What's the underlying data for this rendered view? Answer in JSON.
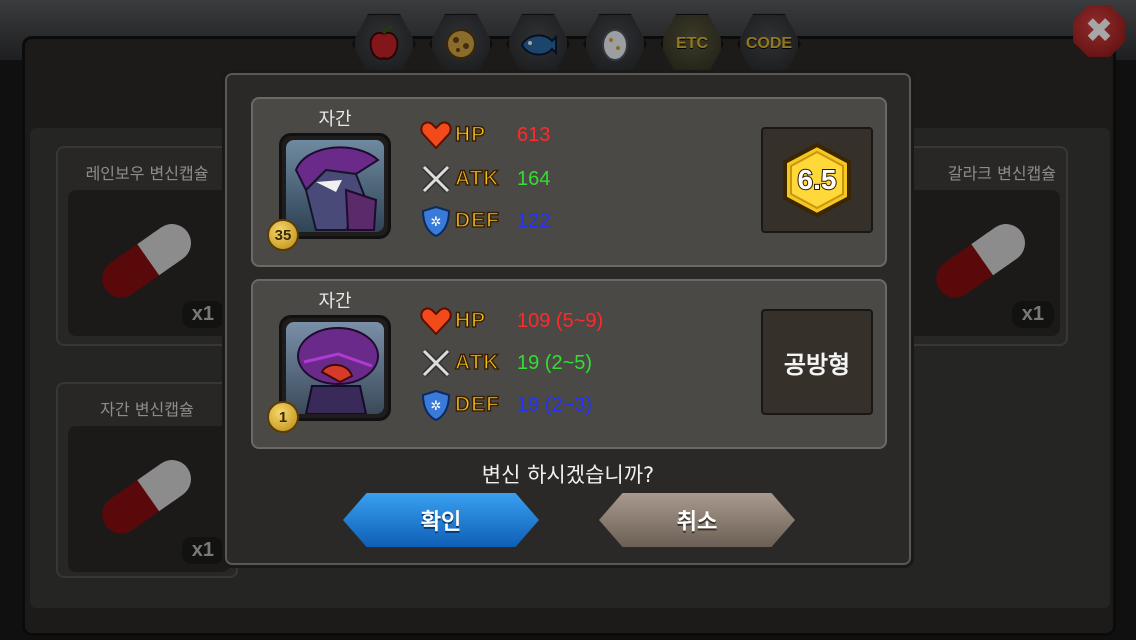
{
  "tabs": [
    {
      "label": "",
      "icon": "apple-icon",
      "active": false
    },
    {
      "label": "",
      "icon": "cookie-icon",
      "active": false
    },
    {
      "label": "",
      "icon": "fish-icon",
      "active": false
    },
    {
      "label": "",
      "icon": "egg-icon",
      "active": false
    },
    {
      "label": "ETC",
      "icon": "",
      "active": true
    },
    {
      "label": "CODE",
      "icon": "",
      "active": false
    }
  ],
  "close": {
    "icon": "close-icon",
    "label": "✖"
  },
  "items": [
    {
      "name": "레인보우 변신캡슐",
      "count": "x1"
    },
    {
      "name": "자간 변신캡슐",
      "count": "x1"
    },
    {
      "name": "갈라크 변신캡슐",
      "count": "x1"
    }
  ],
  "dialog": {
    "current": {
      "name": "자간",
      "level": "35",
      "stats": {
        "hp_label": "HP",
        "hp": "613",
        "atk_label": "ATK",
        "atk": "164",
        "def_label": "DEF",
        "def": "122"
      },
      "grade": "6.5"
    },
    "new": {
      "name": "자간",
      "level": "1",
      "stats": {
        "hp_label": "HP",
        "hp": "109 (5~9)",
        "atk_label": "ATK",
        "atk": "19 (2~5)",
        "def_label": "DEF",
        "def": "19 (2~3)"
      },
      "type": "공방형"
    },
    "question": "변신 하시겠습니까?",
    "confirm_label": "확인",
    "cancel_label": "취소"
  },
  "colors": {
    "hp": "#ff2a2a",
    "atk": "#33dd33",
    "def": "#2233ff",
    "confirm": "#1a7fd6",
    "cancel": "#8c7e73"
  }
}
